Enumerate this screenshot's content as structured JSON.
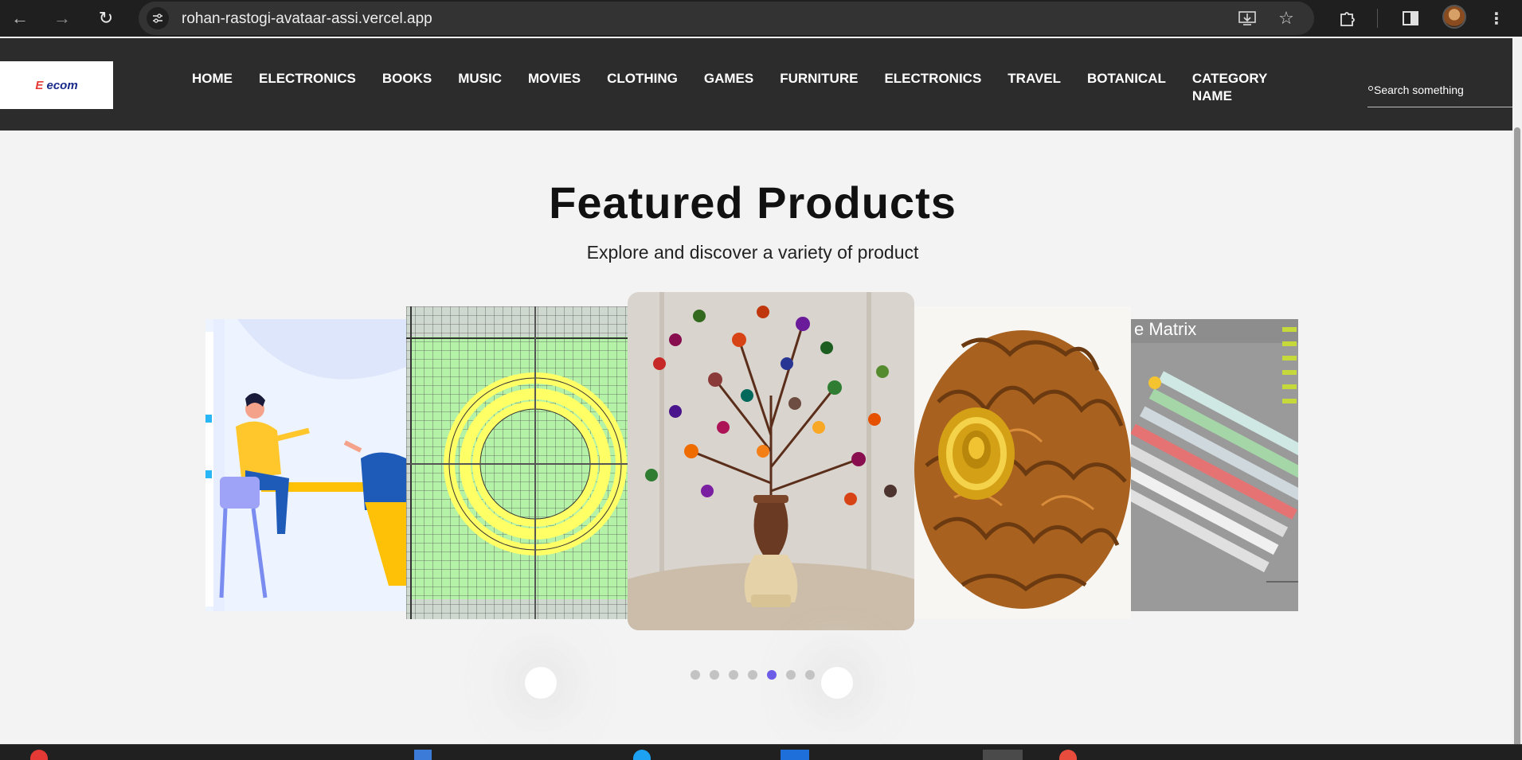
{
  "browser": {
    "url": "rohan-rastogi-avataar-assi.vercel.app"
  },
  "header": {
    "logo_text": "ecom",
    "nav": [
      {
        "label": "HOME"
      },
      {
        "label": "ELECTRONICS"
      },
      {
        "label": "BOOKS"
      },
      {
        "label": "MUSIC"
      },
      {
        "label": "MOVIES"
      },
      {
        "label": "CLOTHING"
      },
      {
        "label": "GAMES"
      },
      {
        "label": "FURNITURE"
      },
      {
        "label": "ELECTRONICS"
      },
      {
        "label": "TRAVEL"
      },
      {
        "label": "BOTANICAL"
      },
      {
        "label": "CATEGORY NAME"
      }
    ],
    "search_placeholder": "Search something"
  },
  "featured": {
    "title": "Featured Products",
    "subtitle": "Explore and discover a variety of product",
    "carousel": {
      "items": [
        {
          "image": "people-meeting-illustration"
        },
        {
          "image": "circle-grid-drawing"
        },
        {
          "image": "bead-tree-vase"
        },
        {
          "image": "rudraksha-gold"
        },
        {
          "image": "matrix-diagram",
          "text": "e Matrix"
        }
      ],
      "dot_count": 7,
      "active_dot": 5
    }
  },
  "colors": {
    "header_bg": "#2c2c2c",
    "page_bg": "#f3f3f3",
    "accent": "#6c5ce7"
  }
}
